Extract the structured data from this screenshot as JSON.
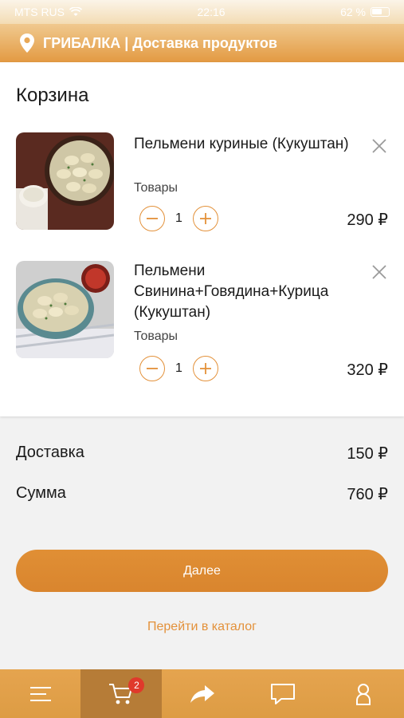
{
  "status_bar": {
    "carrier": "MTS RUS",
    "time": "22:16",
    "battery": "62 %"
  },
  "header": {
    "title": "ГРИБАЛКА | Доставка продуктов",
    "location_icon": "location-pin-icon"
  },
  "cart": {
    "title": "Корзина",
    "items": [
      {
        "name": "Пельмени куриные (Кукуштан)",
        "category": "Товары",
        "qty": "1",
        "price": "290 ₽"
      },
      {
        "name": "Пельмени Свинина+Говядина+Курица (Кукуштан)",
        "category": "Товары",
        "qty": "1",
        "price": "320 ₽"
      }
    ]
  },
  "summary": {
    "delivery_label": "Доставка",
    "delivery_value": "150 ₽",
    "total_label": "Сумма",
    "total_value": "760 ₽"
  },
  "actions": {
    "next_label": "Далее",
    "catalog_link": "Перейти в каталог"
  },
  "tab_bar": {
    "cart_badge": "2",
    "tabs": [
      {
        "icon": "menu-icon"
      },
      {
        "icon": "cart-icon",
        "active": true
      },
      {
        "icon": "share-icon"
      },
      {
        "icon": "chat-icon"
      },
      {
        "icon": "profile-icon"
      }
    ]
  },
  "colors": {
    "accent": "#e3913a",
    "header": "#e39a42",
    "tab_active": "#b67c37",
    "badge": "#e0392b"
  }
}
